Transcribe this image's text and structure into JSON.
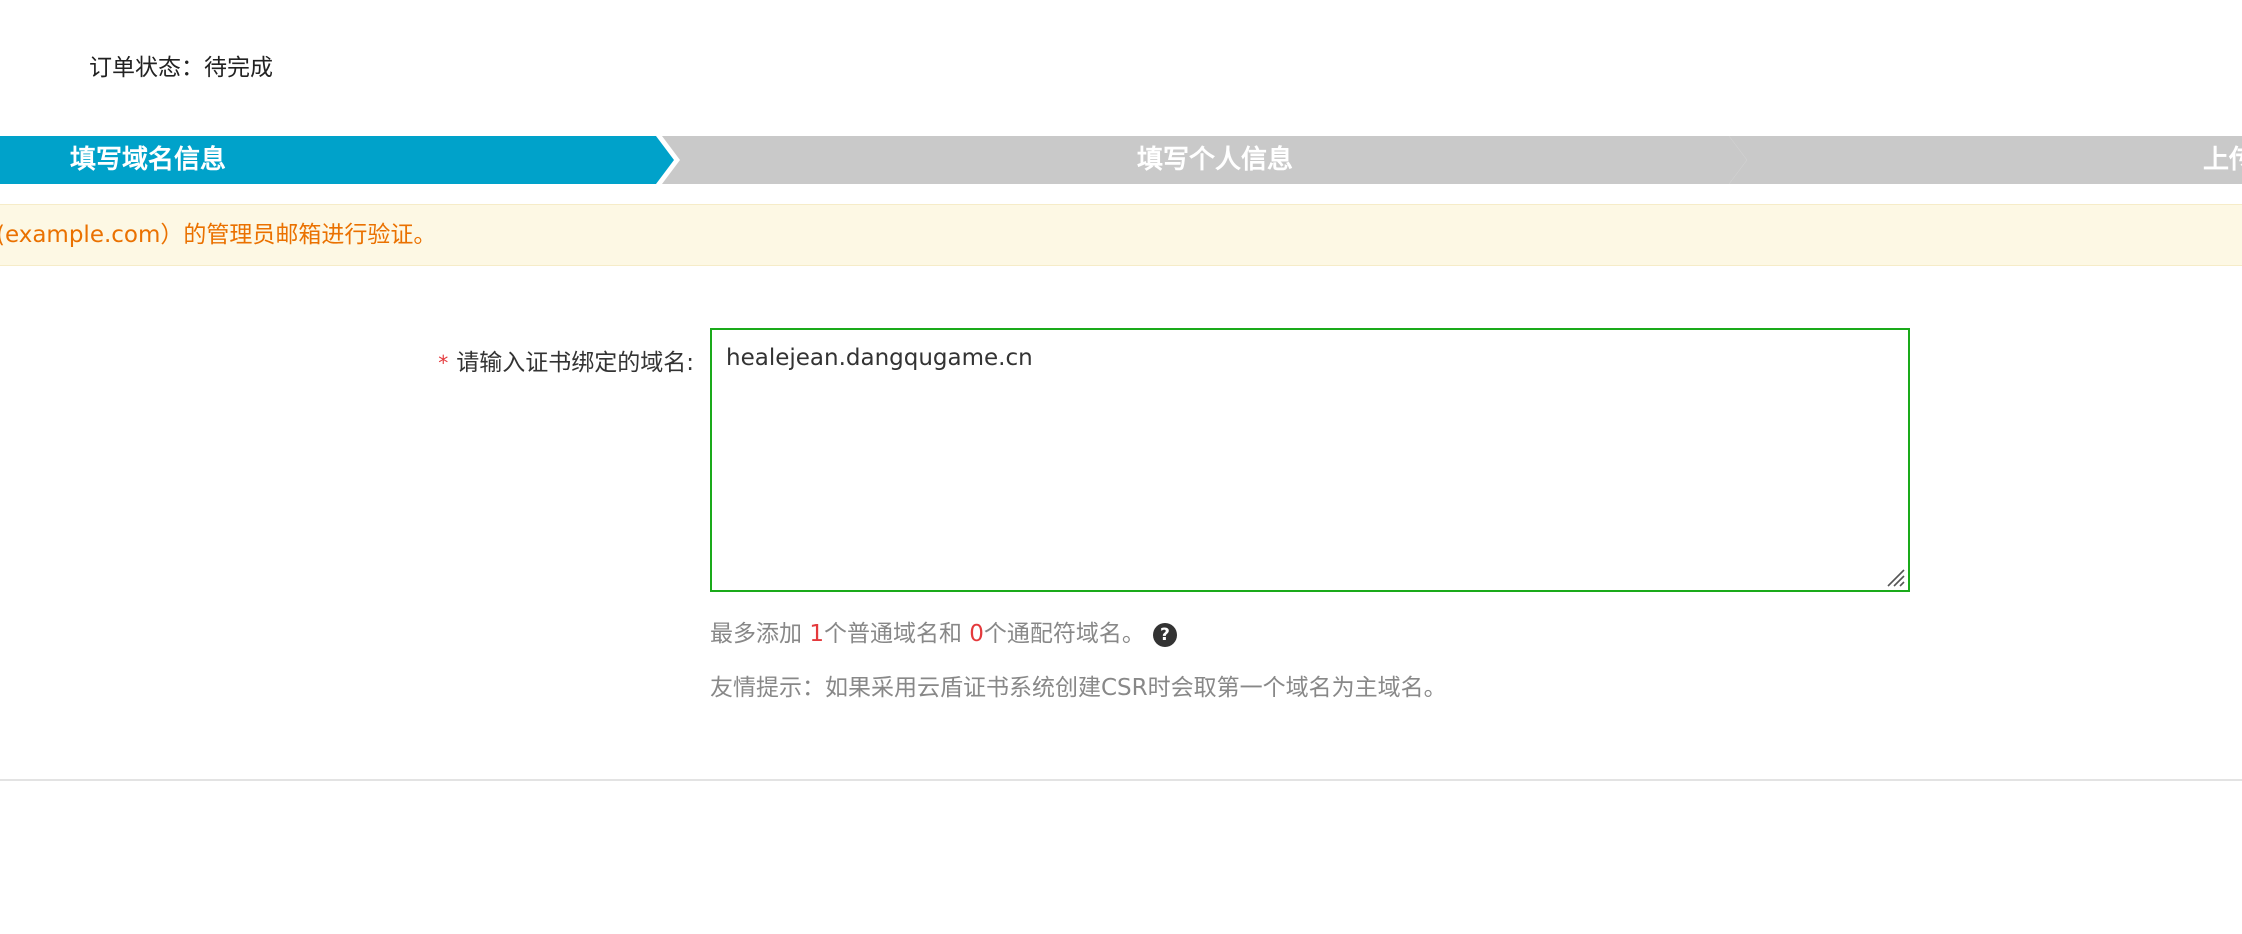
{
  "order_status": {
    "label": "订单状态：",
    "value": "待完成"
  },
  "steps": [
    {
      "label": "填写域名信息",
      "state": "active"
    },
    {
      "label": "填写个人信息",
      "state": "inactive"
    },
    {
      "label": "上传",
      "state": "inactive"
    }
  ],
  "colors": {
    "step_active": "#00a2ca",
    "step_inactive": "#c9c9c9",
    "notice_text": "#ea7100",
    "input_border": "#1aaa1a",
    "required": "#e4393c"
  },
  "notice": {
    "text": "(example.com）的管理员邮箱进行验证。"
  },
  "form": {
    "required_mark": "*",
    "domain_label": "请输入证书绑定的域名:",
    "domain_value": "healejean.dangqugame.cn",
    "limit_hint": {
      "prefix": "最多添加 ",
      "normal_count": "1",
      "middle": "个普通域名和 ",
      "wildcard_count": "0",
      "suffix": "个通配符域名。",
      "help_icon": "?"
    },
    "tip": "友情提示：如果采用云盾证书系统创建CSR时会取第一个域名为主域名。"
  }
}
